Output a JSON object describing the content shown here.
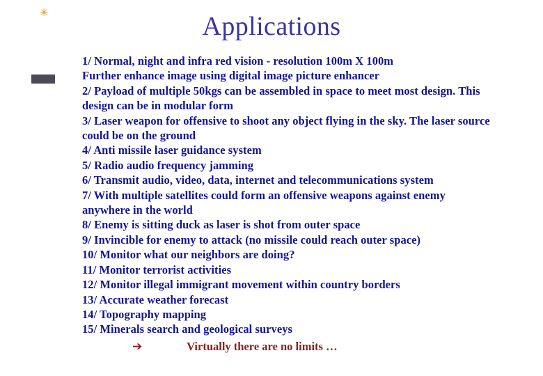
{
  "slide": {
    "title": "Applications",
    "decorations": {
      "sparkle_icon": "✳",
      "sparkle_color": "#e08a1e",
      "bar_color": "#4b4b57"
    },
    "colors": {
      "title": "#3a34a0",
      "body": "#141496",
      "accent": "#8e1f20",
      "background": "#ffffff"
    },
    "body_lines": [
      "1/ Normal, night  and infra red vision - resolution 100m X 100m",
      "Further enhance image using digital image picture enhancer",
      "2/ Payload of multiple 50kgs can be assembled in space to meet most design. This",
      "design can be in modular form",
      "3/ Laser weapon for offensive to shoot any object flying in the sky. The laser source",
      "could be on the ground",
      "4/ Anti missile laser guidance system",
      "5/ Radio audio frequency jamming",
      "6/ Transmit audio, video, data, internet and telecommunications system",
      "7/ With multiple satellites could form an offensive weapons against enemy",
      "anywhere in the world",
      "8/ Enemy is sitting duck as laser is shot from outer space",
      "9/ Invincible for enemy to attack (no missile could reach outer space)",
      "10/ Monitor what our neighbors are doing?",
      "11/ Monitor terrorist activities",
      "12/ Monitor illegal immigrant movement within country borders",
      "13/ Accurate weather forecast",
      "14/ Topography mapping",
      "15/  Minerals search and geological surveys"
    ],
    "closing": {
      "arrow_icon": "➔",
      "text": "Virtually there are no limits …"
    }
  }
}
